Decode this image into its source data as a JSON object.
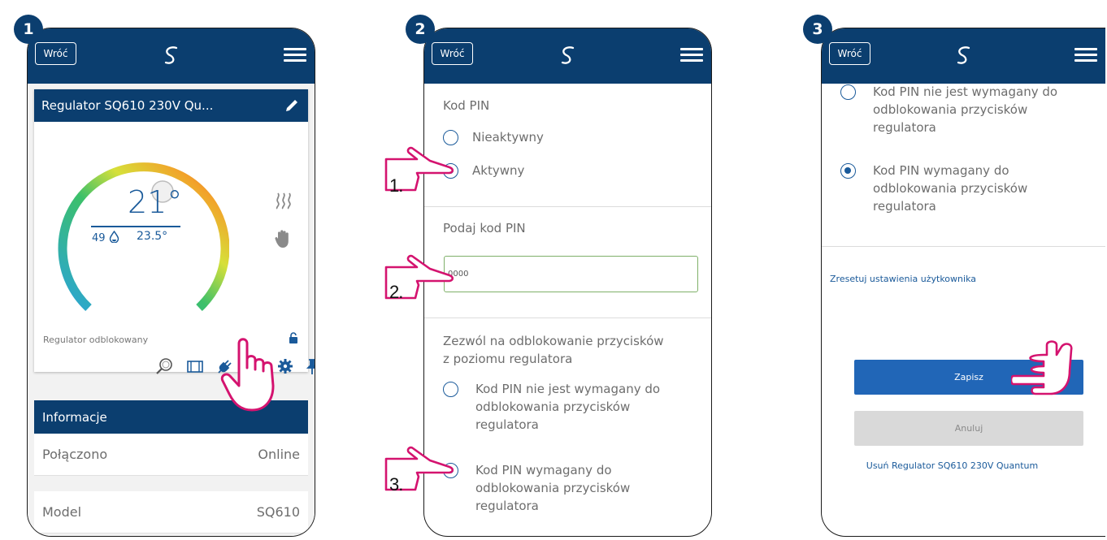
{
  "steps": [
    "1",
    "2",
    "3"
  ],
  "common": {
    "back_label": "Wróć",
    "logo_icon": "salus-logo-icon",
    "menu_icon": "hamburger-menu-icon"
  },
  "screen1": {
    "device_title": "Regulator SQ610 230V Qu...",
    "setpoint": "21°",
    "humidity": "49",
    "current_temp": "23.5°",
    "status_text": "Regulator odblokowany",
    "info_header": "Informacje",
    "info_rows": [
      {
        "label": "Połączono",
        "value": "Online"
      },
      {
        "label": "Model",
        "value": "SQ610"
      }
    ],
    "colors": {
      "brand": "#0b3e6f",
      "temp": "#1a5a9a"
    }
  },
  "screen2": {
    "pin_code_label": "Kod PIN",
    "pin_inactive": "Nieaktywny",
    "pin_active": "Aktywny",
    "pin_entry_label": "Podaj kod PIN",
    "pin_value": "0000",
    "unlock_label_1": "Zezwól na odblokowanie przycisków",
    "unlock_label_2": "z poziomu regulatora",
    "opt_not_required": [
      "Kod PIN nie jest wymagany do",
      "odblokowania przycisków",
      "regulatora"
    ],
    "opt_required": [
      "Kod PIN wymagany do",
      "odblokowania przycisków",
      "regulatora"
    ],
    "annotations": [
      "1.",
      "2.",
      "3."
    ]
  },
  "screen3": {
    "opt_not_required": [
      "Kod PIN nie jest wymagany do",
      "odblokowania przycisków",
      "regulatora"
    ],
    "opt_required": [
      "Kod PIN wymagany do",
      "odblokowania przycisków",
      "regulatora"
    ],
    "reset_link": "Zresetuj ustawienia użytkownika",
    "save_label": "Zapisz",
    "cancel_label": "Anuluj",
    "delete_link": "Usuń Regulator SQ610 230V Quantum"
  }
}
